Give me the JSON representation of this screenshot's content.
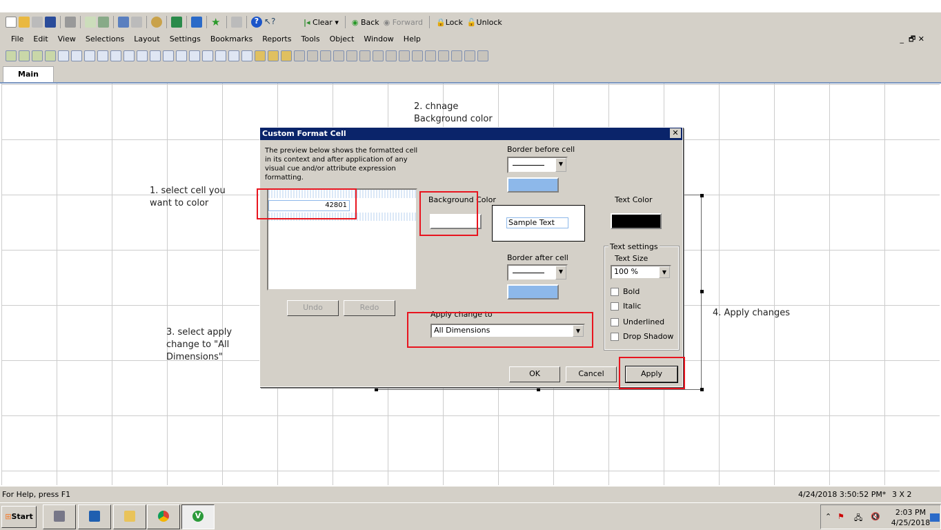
{
  "toolbar1": {
    "icons": [
      "new-icon",
      "open-icon",
      "reload-icon",
      "save-icon",
      "print-icon",
      "edit-script-icon",
      "reload-data-icon",
      "undo-icon",
      "redo-icon",
      "search-icon",
      "check-icon",
      "chart-wizard-icon",
      "favorite-star-icon",
      "edit-icon",
      "help-icon",
      "whats-this-icon"
    ],
    "clear": "Clear",
    "back": "Back",
    "forward": "Forward",
    "lock": "Lock",
    "unlock": "Unlock"
  },
  "menu": [
    "File",
    "Edit",
    "View",
    "Selections",
    "Layout",
    "Settings",
    "Bookmarks",
    "Reports",
    "Tools",
    "Object",
    "Window",
    "Help"
  ],
  "tab": "Main",
  "annotations": {
    "a1": "1. select cell you want to color",
    "a2": "2. chnage Background color",
    "a3": "3. select apply change to \"All Dimensions\"",
    "a4": "4. Apply changes"
  },
  "dialog": {
    "title": "Custom Format Cell",
    "description": "The preview below shows the formatted cell in its context and after application of any visual cue and/or attribute expression formatting.",
    "preview_value": "42801",
    "undo": "Undo",
    "redo": "Redo",
    "border_before": "Border before cell",
    "border_after": "Border after cell",
    "background_color": "Background Color",
    "text_color": "Text Color",
    "sample_text": "Sample Text",
    "text_settings": "Text settings",
    "text_size_label": "Text Size",
    "text_size": "100 %",
    "bold": "Bold",
    "italic": "Italic",
    "underlined": "Underlined",
    "drop_shadow": "Drop Shadow",
    "apply_change_to": "Apply change to",
    "apply_change_value": "All Dimensions",
    "ok": "OK",
    "cancel": "Cancel",
    "apply": "Apply",
    "colors": {
      "border": "#8db8ea",
      "background": "#ffffff",
      "text": "#000000"
    }
  },
  "status": {
    "help": "For Help, press F1",
    "timestamp": "4/24/2018 3:50:52 PM*",
    "grid": "3 X 2"
  },
  "taskbar": {
    "start": "Start",
    "time": "2:03 PM",
    "date": "4/25/2018"
  }
}
